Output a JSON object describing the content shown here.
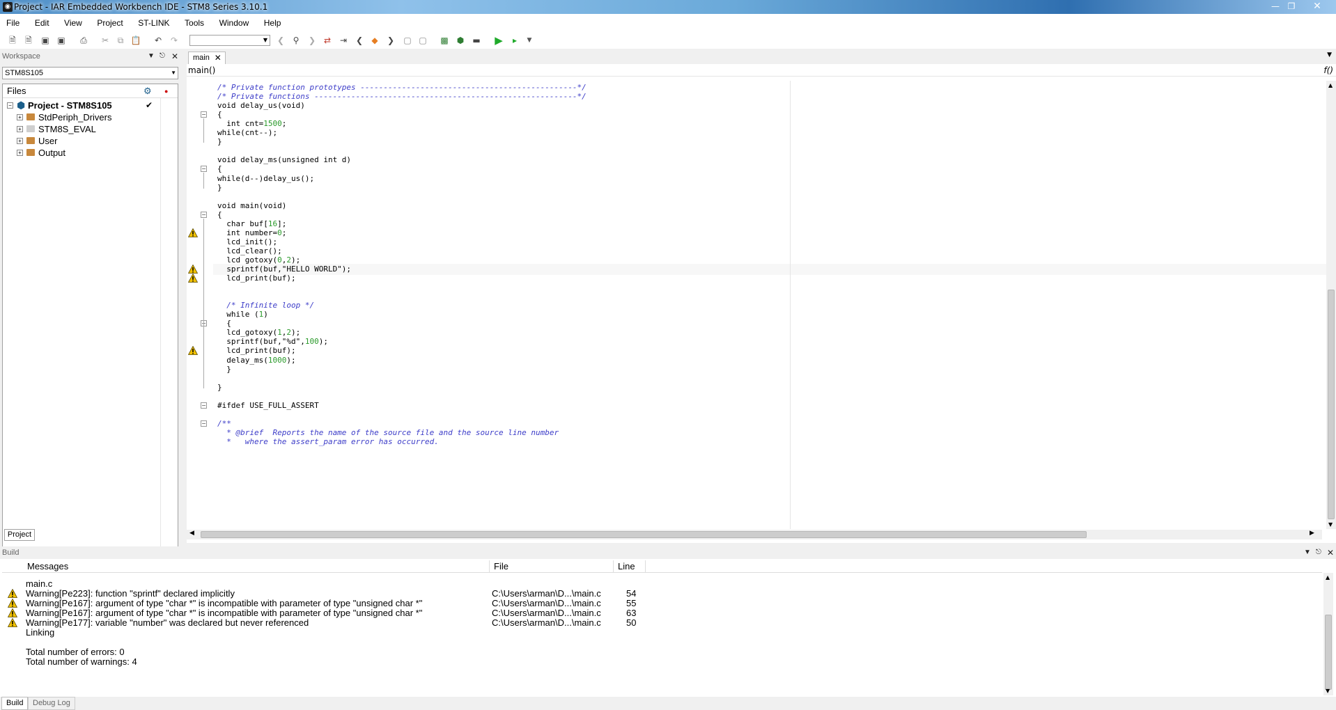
{
  "window": {
    "title": "Project - IAR Embedded Workbench IDE - STM8 Series 3.10.1",
    "controls": [
      "minimize",
      "restore",
      "close"
    ]
  },
  "menu": [
    "File",
    "Edit",
    "View",
    "Project",
    "ST-LINK",
    "Tools",
    "Window",
    "Help"
  ],
  "workspace": {
    "header": "Workspace",
    "configuration": "STM8S105",
    "files_header": "Files",
    "project": "Project - STM8S105",
    "groups": [
      "StdPeriph_Drivers",
      "STM8S_EVAL",
      "User",
      "Output"
    ],
    "bottom_tab": "Project"
  },
  "editor": {
    "tab": "main",
    "function": "main()",
    "lines": [
      {
        "text": "/* Private function prototypes -----------------------------------------------*/",
        "type": "comment"
      },
      {
        "text": "/* Private functions ---------------------------------------------------------*/",
        "type": "comment"
      },
      {
        "text": "void delay_us(void)",
        "type": "code"
      },
      {
        "text": "{",
        "type": "code"
      },
      {
        "text": "  int cnt=1500;",
        "type": "code"
      },
      {
        "text": "while(cnt--);",
        "type": "code"
      },
      {
        "text": "}",
        "type": "code"
      },
      {
        "text": "",
        "type": "code"
      },
      {
        "text": "void delay_ms(unsigned int d)",
        "type": "code"
      },
      {
        "text": "{",
        "type": "code"
      },
      {
        "text": "while(d--)delay_us();",
        "type": "code"
      },
      {
        "text": "}",
        "type": "code"
      },
      {
        "text": "",
        "type": "code"
      },
      {
        "text": "void main(void)",
        "type": "code"
      },
      {
        "text": "{",
        "type": "code"
      },
      {
        "text": "  char buf[16];",
        "type": "code"
      },
      {
        "text": "  int number=0;",
        "type": "code"
      },
      {
        "text": "  lcd_init();",
        "type": "code"
      },
      {
        "text": "  lcd_clear();",
        "type": "code"
      },
      {
        "text": "  lcd_gotoxy(0,2);",
        "type": "code"
      },
      {
        "text": "  sprintf(buf,\"HELLO WORLD\");",
        "type": "code"
      },
      {
        "text": "  lcd_print(buf);",
        "type": "code"
      },
      {
        "text": "",
        "type": "code"
      },
      {
        "text": "",
        "type": "code"
      },
      {
        "text": "  /* Infinite loop */",
        "type": "comment"
      },
      {
        "text": "  while (1)",
        "type": "code"
      },
      {
        "text": "  {",
        "type": "code"
      },
      {
        "text": "  lcd_gotoxy(1,2);",
        "type": "code"
      },
      {
        "text": "  sprintf(buf,\"%d\",100);",
        "type": "code"
      },
      {
        "text": "  lcd_print(buf);",
        "type": "code"
      },
      {
        "text": "  delay_ms(1000);",
        "type": "code"
      },
      {
        "text": "  }",
        "type": "code"
      },
      {
        "text": "",
        "type": "code"
      },
      {
        "text": "}",
        "type": "code"
      },
      {
        "text": "",
        "type": "code"
      },
      {
        "text": "#ifdef USE_FULL_ASSERT",
        "type": "code"
      },
      {
        "text": "",
        "type": "code"
      },
      {
        "text": "/**",
        "type": "comment"
      },
      {
        "text": "  * @brief  Reports the name of the source file and the source line number",
        "type": "comment"
      },
      {
        "text": "  *   where the assert_param error has occurred.",
        "type": "comment"
      }
    ]
  },
  "build": {
    "header": "Build",
    "columns": {
      "messages": "Messages",
      "file": "File",
      "line": "Line"
    },
    "rows": [
      {
        "icon": "",
        "message": "main.c",
        "file": "",
        "line": ""
      },
      {
        "icon": "warning",
        "message": "Warning[Pe223]: function \"sprintf\" declared implicitly",
        "file": "C:\\Users\\arman\\D...\\main.c",
        "line": "54"
      },
      {
        "icon": "warning",
        "message": "Warning[Pe167]: argument of type \"char *\" is incompatible with parameter of type \"unsigned char *\"",
        "file": "C:\\Users\\arman\\D...\\main.c",
        "line": "55"
      },
      {
        "icon": "warning",
        "message": "Warning[Pe167]: argument of type \"char *\" is incompatible with parameter of type \"unsigned char *\"",
        "file": "C:\\Users\\arman\\D...\\main.c",
        "line": "63"
      },
      {
        "icon": "warning",
        "message": "Warning[Pe177]: variable \"number\" was declared but never referenced",
        "file": "C:\\Users\\arman\\D...\\main.c",
        "line": "50"
      },
      {
        "icon": "",
        "message": "Linking",
        "file": "",
        "line": ""
      },
      {
        "icon": "",
        "message": "",
        "file": "",
        "line": ""
      },
      {
        "icon": "",
        "message": "Total number of errors: 0",
        "file": "",
        "line": ""
      },
      {
        "icon": "",
        "message": "Total number of warnings: 4",
        "file": "",
        "line": ""
      }
    ],
    "tabs": [
      "Build",
      "Debug Log"
    ]
  },
  "colors": {
    "comment": "#3c3cc8",
    "number": "#2a9a2a",
    "warning": "#f2c200",
    "folder": "#c8883c",
    "project_icon": "#1b5e8a"
  }
}
